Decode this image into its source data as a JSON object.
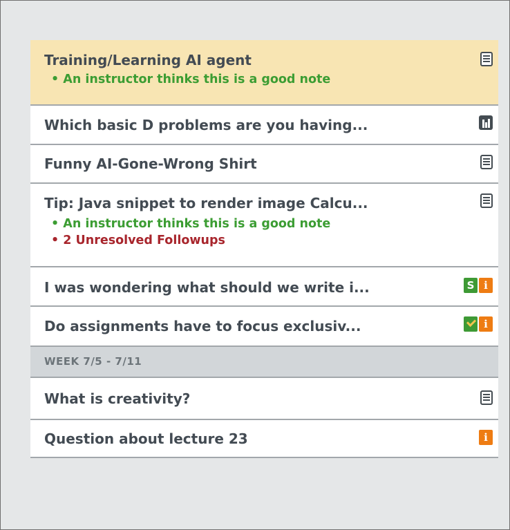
{
  "feed": {
    "items": [
      {
        "title": "Training/Learning AI agent",
        "good_note": "• An instructor thinks this is a good note",
        "icon": "note-icon"
      },
      {
        "title": "Which basic D problems are you having...",
        "icon": "poll-icon"
      },
      {
        "title": "Funny AI-Gone-Wrong Shirt",
        "icon": "note-icon"
      },
      {
        "title": "Tip: Java snippet to render image Calcu...",
        "good_note": "• An instructor thinks this is a good note",
        "unresolved": "• 2 Unresolved Followups",
        "icon": "note-icon"
      },
      {
        "title": "I was wondering what should we write i...",
        "icons": [
          "student-answer-icon",
          "instructor-info-icon"
        ],
        "s_label": "S",
        "i_label": "i"
      },
      {
        "title": "Do assignments have to focus exclusiv...",
        "icons": [
          "endorsed-icon",
          "instructor-info-icon"
        ],
        "i_label": "i"
      }
    ],
    "week_header": "WEEK 7/5 - 7/11",
    "week_items": [
      {
        "title": "What is creativity?",
        "icon": "note-icon"
      },
      {
        "title": "Question about lecture 23",
        "icon": "instructor-info-icon",
        "i_label": "i"
      }
    ]
  },
  "colors": {
    "highlight": "#f8e5b3",
    "good_note": "#3c9d33",
    "unresolved": "#a8252c",
    "title": "#434b53",
    "green_badge": "#3e9a35",
    "orange_badge": "#ee7c13"
  }
}
